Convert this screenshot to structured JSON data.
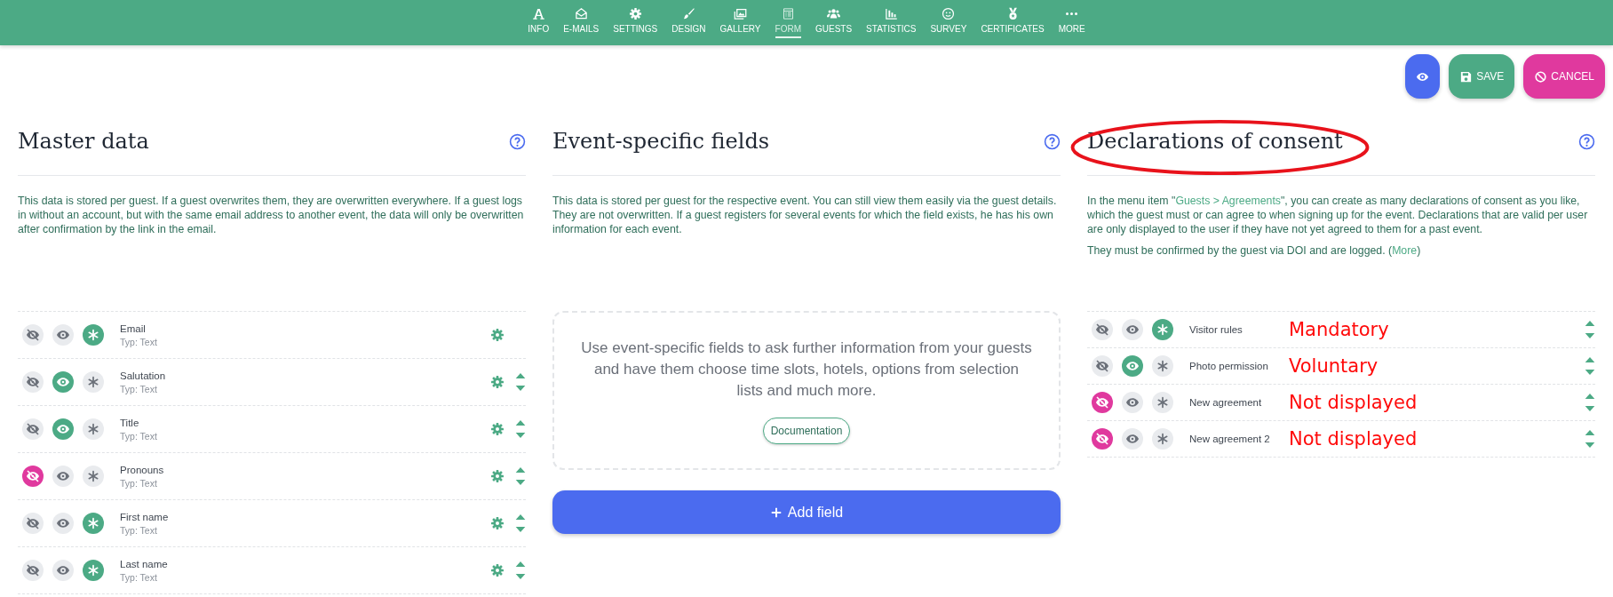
{
  "nav": [
    {
      "label": "INFO",
      "kind": "font",
      "selected": false
    },
    {
      "label": "E-MAILS",
      "kind": "envelope",
      "selected": false
    },
    {
      "label": "SETTINGS",
      "kind": "gear",
      "selected": false
    },
    {
      "label": "DESIGN",
      "kind": "brush",
      "selected": false
    },
    {
      "label": "GALLERY",
      "kind": "images",
      "selected": false
    },
    {
      "label": "FORM",
      "kind": "form",
      "selected": true
    },
    {
      "label": "GUESTS",
      "kind": "users",
      "selected": false
    },
    {
      "label": "STATISTICS",
      "kind": "chart",
      "selected": false
    },
    {
      "label": "SURVEY",
      "kind": "smile",
      "selected": false
    },
    {
      "label": "CERTIFICATES",
      "kind": "medal",
      "selected": false
    },
    {
      "label": "MORE",
      "kind": "dots",
      "selected": false
    }
  ],
  "actions": [
    {
      "kind": "preview"
    },
    {
      "kind": "save",
      "label": "SAVE"
    },
    {
      "kind": "cancel",
      "label": "CANCEL"
    }
  ],
  "columns": [
    {
      "kind": "fields",
      "title": "Master data",
      "circled": false,
      "description": [
        [
          {
            "text": "This data is stored per guest. If a guest overwrites them, they are overwritten everywhere. If a guest logs in without an account, but with the same email address to another event, the data will only be overwritten after confirmation by the link in the email."
          }
        ]
      ],
      "rows": [
        {
          "label": "Email",
          "sub": "Typ: Text",
          "settings": true,
          "sortable": false,
          "toggles": [
            {
              "kind": "hidden",
              "selected": false
            },
            {
              "kind": "visible",
              "selected": false
            },
            {
              "kind": "mandatory",
              "selected": true
            }
          ]
        },
        {
          "label": "Salutation",
          "sub": "Typ: Text",
          "settings": true,
          "sortable": true,
          "toggles": [
            {
              "kind": "hidden",
              "selected": false
            },
            {
              "kind": "visible",
              "selected": true
            },
            {
              "kind": "mandatory",
              "selected": false
            }
          ]
        },
        {
          "label": "Title",
          "sub": "Typ: Text",
          "settings": true,
          "sortable": true,
          "toggles": [
            {
              "kind": "hidden",
              "selected": false
            },
            {
              "kind": "visible",
              "selected": true
            },
            {
              "kind": "mandatory",
              "selected": false
            }
          ]
        },
        {
          "label": "Pronouns",
          "sub": "Typ: Text",
          "settings": true,
          "sortable": true,
          "toggles": [
            {
              "kind": "hidden",
              "selected": true
            },
            {
              "kind": "visible",
              "selected": false
            },
            {
              "kind": "mandatory",
              "selected": false
            }
          ]
        },
        {
          "label": "First name",
          "sub": "Typ: Text",
          "settings": true,
          "sortable": true,
          "toggles": [
            {
              "kind": "hidden",
              "selected": false
            },
            {
              "kind": "visible",
              "selected": false
            },
            {
              "kind": "mandatory",
              "selected": true
            }
          ]
        },
        {
          "label": "Last name",
          "sub": "Typ: Text",
          "settings": true,
          "sortable": true,
          "toggles": [
            {
              "kind": "hidden",
              "selected": false
            },
            {
              "kind": "visible",
              "selected": false
            },
            {
              "kind": "mandatory",
              "selected": true
            }
          ]
        }
      ]
    },
    {
      "kind": "placeholder",
      "title": "Event-specific fields",
      "circled": false,
      "description": [
        [
          {
            "text": "This data is stored per guest for the respective event. You can still view them easily via the guest details.\nThey are not overwritten. If a guest registers for several events for which the field exists, he has his own information for each event."
          }
        ]
      ],
      "empty_state": {
        "text": "Use event-specific fields to ask further information from your guests and have them choose time slots, hotels, options from selection lists and much more.",
        "button": "Documentation"
      },
      "add_button": "Add field"
    },
    {
      "kind": "consents",
      "title": "Declarations of consent",
      "circled": true,
      "description": [
        [
          {
            "text": "In the menu item \""
          },
          {
            "text": "Guests > Agreements",
            "link": true
          },
          {
            "text": "\", you can create as many declarations of consent as you like, which the guest must or can agree to when signing up for the event. Declarations that are valid per user are only displayed to the user if they have not yet agreed to them for a past event."
          }
        ],
        [
          {
            "text": "They must be confirmed by the guest via DOI and are logged. ("
          },
          {
            "text": "More",
            "link": true
          },
          {
            "text": ")"
          }
        ]
      ],
      "rows": [
        {
          "label": "Visitor rules",
          "note": "Mandatory",
          "sortable": true,
          "toggles": [
            {
              "kind": "hidden",
              "selected": false
            },
            {
              "kind": "visible",
              "selected": false
            },
            {
              "kind": "mandatory",
              "selected": true
            }
          ]
        },
        {
          "label": "Photo permission",
          "note": "Voluntary",
          "sortable": true,
          "toggles": [
            {
              "kind": "hidden",
              "selected": false
            },
            {
              "kind": "visible",
              "selected": true
            },
            {
              "kind": "mandatory",
              "selected": false
            }
          ]
        },
        {
          "label": "New agreement",
          "note": "Not displayed",
          "sortable": true,
          "toggles": [
            {
              "kind": "hidden",
              "selected": true
            },
            {
              "kind": "visible",
              "selected": false
            },
            {
              "kind": "mandatory",
              "selected": false
            }
          ]
        },
        {
          "label": "New agreement 2",
          "note": "Not displayed",
          "sortable": true,
          "toggles": [
            {
              "kind": "hidden",
              "selected": true
            },
            {
              "kind": "visible",
              "selected": false
            },
            {
              "kind": "mandatory",
              "selected": false
            }
          ]
        }
      ]
    }
  ]
}
